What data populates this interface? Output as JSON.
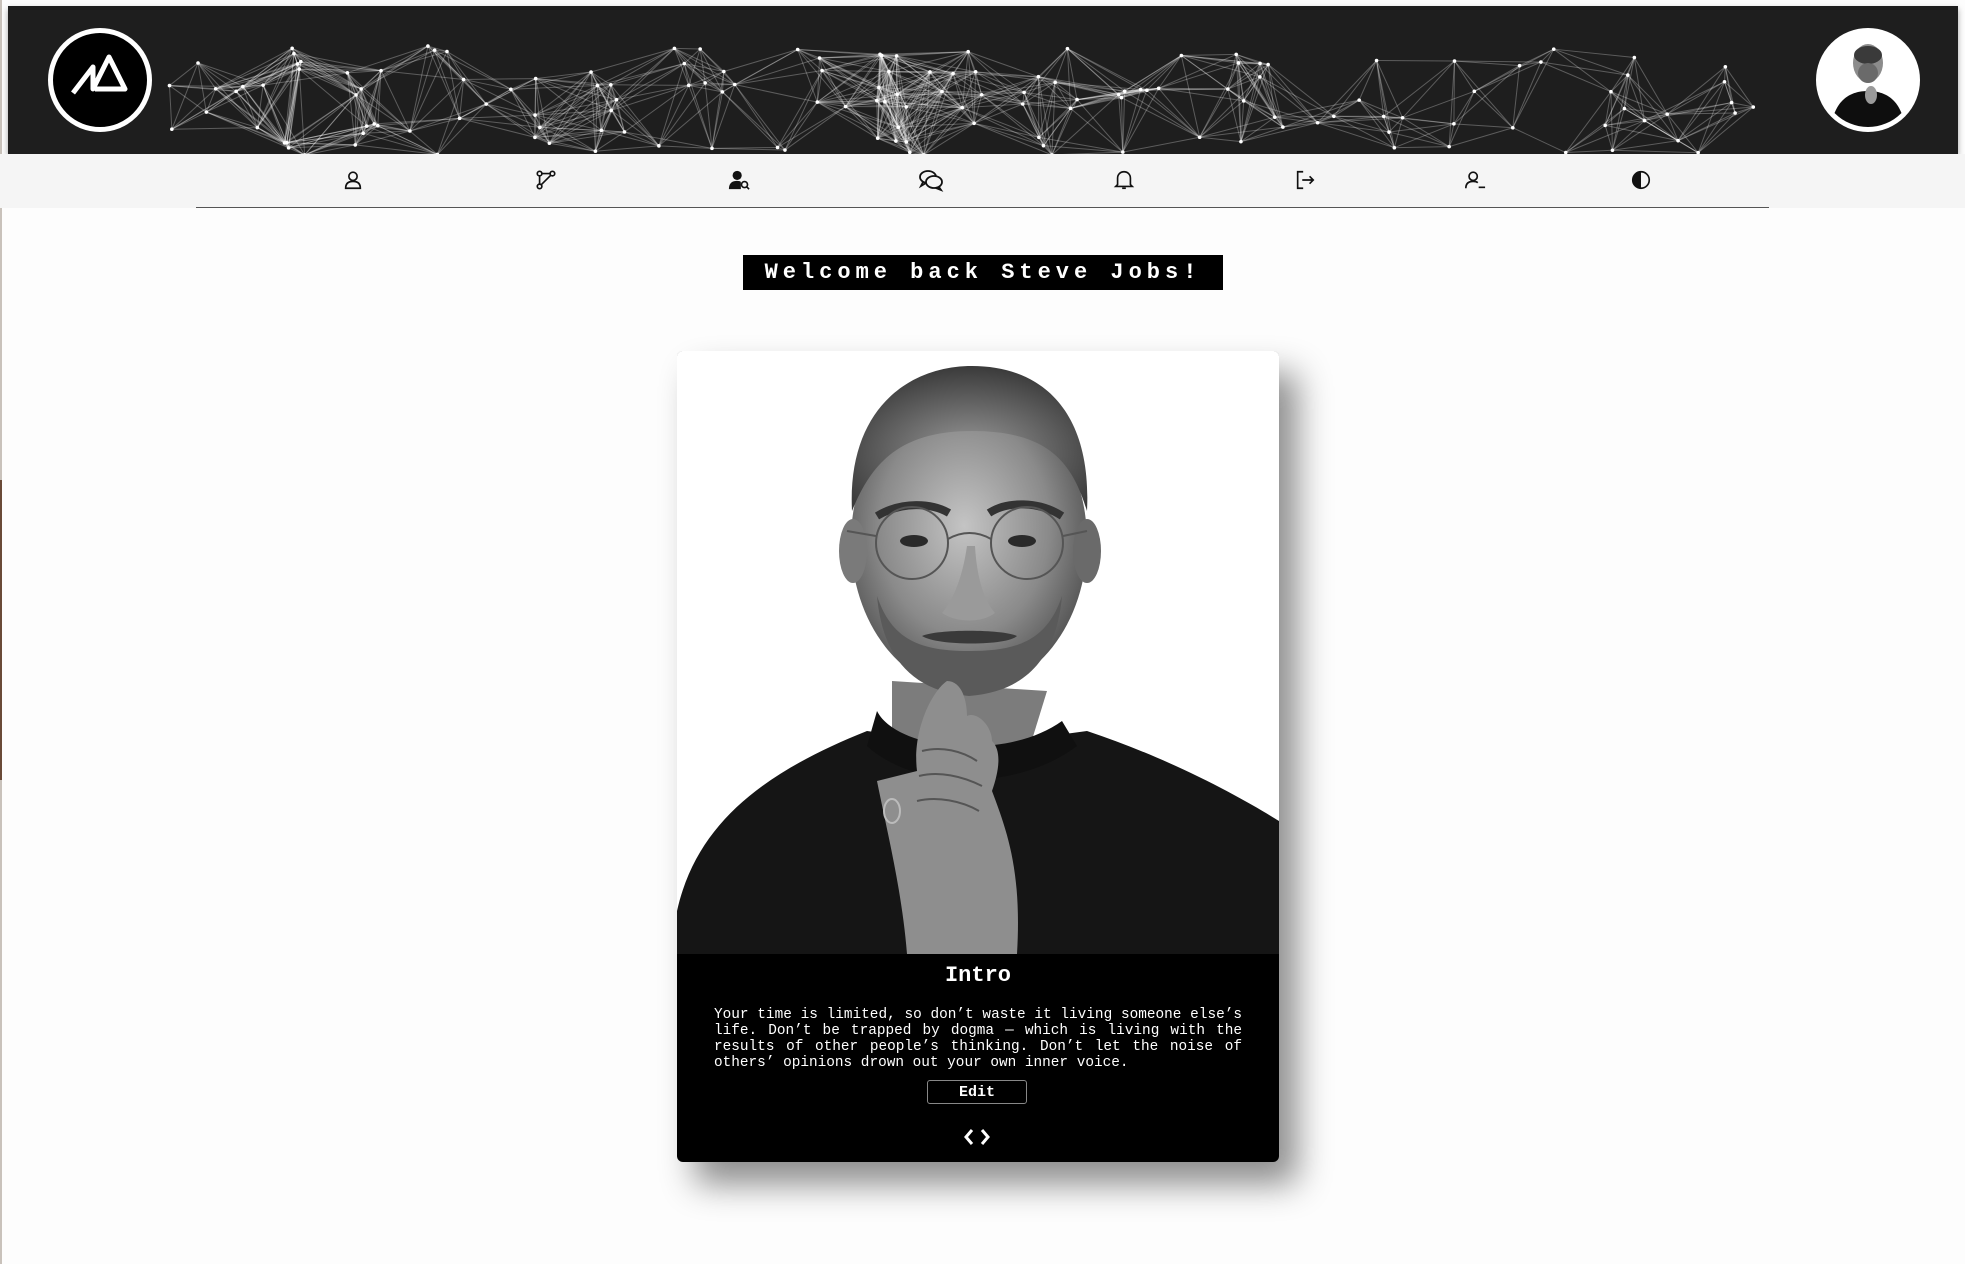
{
  "header": {
    "logo_icon": "triangle-z-logo-icon",
    "avatar_alt": "user-avatar"
  },
  "nav": {
    "items": [
      {
        "icon": "user-icon"
      },
      {
        "icon": "network-graph-icon"
      },
      {
        "icon": "user-search-icon"
      },
      {
        "icon": "chat-bubbles-icon"
      },
      {
        "icon": "bell-icon"
      },
      {
        "icon": "logout-icon"
      },
      {
        "icon": "user-minus-icon"
      },
      {
        "icon": "contrast-toggle-icon"
      }
    ]
  },
  "welcome": {
    "text": "Welcome back Steve Jobs!"
  },
  "card": {
    "title": "Intro",
    "text": "Your time is limited, so don’t waste it living someone else’s life. Don’t be trapped by dogma — which is living with the results of other people’s thinking. Don’t let the noise of others’ opinions drown out your own inner voice.",
    "edit_label": "Edit",
    "code_icon": "code-brackets-icon"
  },
  "colors": {
    "header_bg": "#1e1e1e",
    "card_bg": "#000000",
    "page_bg": "#fdfdfd",
    "nav_bg": "#f5f5f5"
  }
}
